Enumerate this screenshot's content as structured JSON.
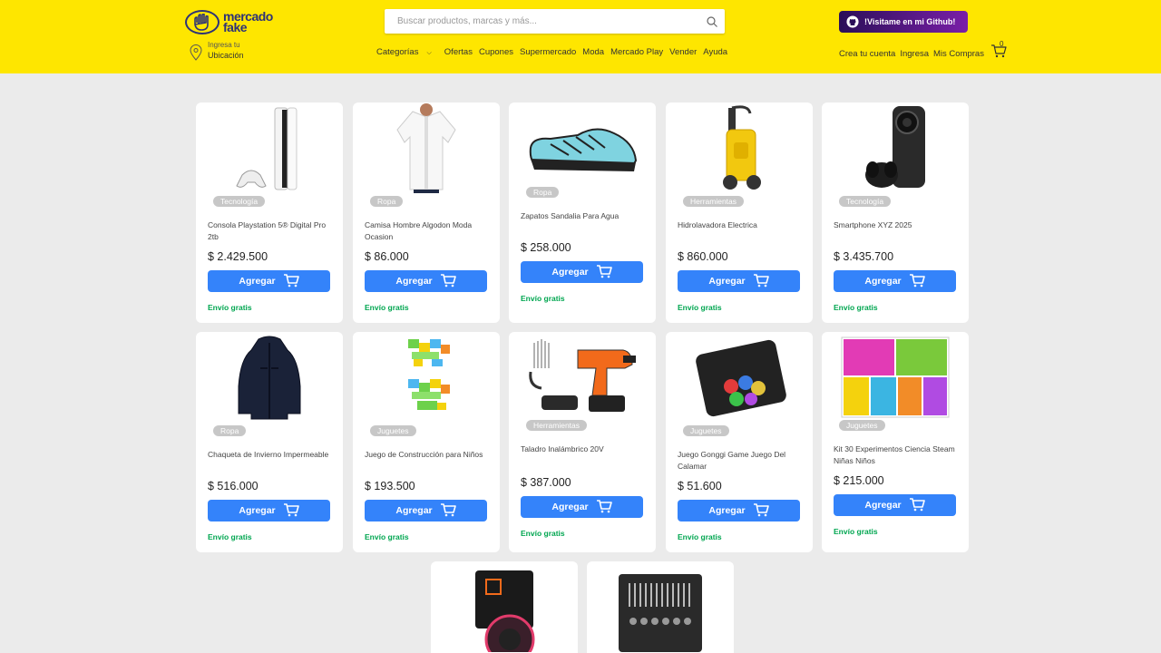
{
  "header": {
    "logo_line1": "mercado",
    "logo_line2": "fake",
    "search_placeholder": "Buscar productos, marcas y más...",
    "github_label": "!Visitame en mi Github!",
    "location_small": "Ingresa tu",
    "location_big": "Ubicación",
    "nav": [
      "Categorías",
      "Ofertas",
      "Cupones",
      "Supermercado",
      "Moda",
      "Mercado Play",
      "Vender",
      "Ayuda"
    ],
    "account": [
      "Crea tu cuenta",
      "Ingresa",
      "Mis Compras"
    ],
    "cart_count": "0"
  },
  "products": [
    {
      "category": "Tecnología",
      "title": "Consola Playstation 5® Digital Pro 2tb",
      "price": "$ 2.429.500",
      "add": "Agregar",
      "shipping": "Envío gratis",
      "icon": "console"
    },
    {
      "category": "Ropa",
      "title": "Camisa Hombre Algodon Moda Ocasion",
      "price": "$ 86.000",
      "add": "Agregar",
      "shipping": "Envío gratis",
      "icon": "shirt"
    },
    {
      "category": "Ropa",
      "title": "Zapatos Sandalia Para Agua",
      "price": "$ 258.000",
      "add": "Agregar",
      "shipping": "Envío gratis",
      "icon": "shoe"
    },
    {
      "category": "Herramientas",
      "title": "Hidrolavadora Electrica",
      "price": "$ 860.000",
      "add": "Agregar",
      "shipping": "Envío gratis",
      "icon": "washer"
    },
    {
      "category": "Tecnología",
      "title": "Smartphone XYZ 2025",
      "price": "$ 3.435.700",
      "add": "Agregar",
      "shipping": "Envío gratis",
      "icon": "phone"
    },
    {
      "category": "Ropa",
      "title": "Chaqueta de Invierno Impermeable",
      "price": "$ 516.000",
      "add": "Agregar",
      "shipping": "Envío gratis",
      "icon": "jacket"
    },
    {
      "category": "Juguetes",
      "title": "Juego de Construcción para Niños",
      "price": "$ 193.500",
      "add": "Agregar",
      "shipping": "Envío gratis",
      "icon": "blocks"
    },
    {
      "category": "Herramientas",
      "title": "Taladro Inalámbrico 20V",
      "price": "$ 387.000",
      "add": "Agregar",
      "shipping": "Envío gratis",
      "icon": "drill"
    },
    {
      "category": "Juguetes",
      "title": "Juego Gonggi Game Juego Del Calamar",
      "price": "$ 51.600",
      "add": "Agregar",
      "shipping": "Envío gratis",
      "icon": "game"
    },
    {
      "category": "Juguetes",
      "title": "Kit 30 Experimentos Ciencia Steam Niñas Niños",
      "price": "$ 215.000",
      "add": "Agregar",
      "shipping": "Envío gratis",
      "icon": "kit"
    },
    {
      "category": "",
      "title": "",
      "price": "",
      "add": "",
      "shipping": "",
      "icon": "cpu"
    },
    {
      "category": "",
      "title": "",
      "price": "",
      "add": "",
      "shipping": "",
      "icon": "toolbox"
    }
  ]
}
